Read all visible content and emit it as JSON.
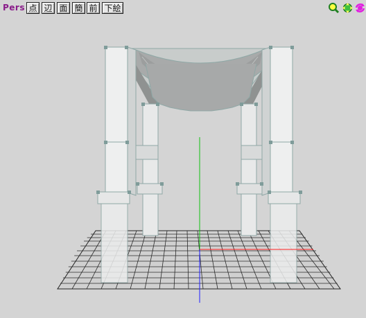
{
  "toolbar": {
    "view_mode": "Pers",
    "buttons": [
      {
        "label": "点"
      },
      {
        "label": "辺"
      },
      {
        "label": "面"
      },
      {
        "label": "簡"
      },
      {
        "label": "前"
      },
      {
        "label": "下絵"
      }
    ],
    "icons": [
      "zoom-icon",
      "move-icon",
      "rotate-icon"
    ]
  },
  "colors": {
    "view_label": "#8a1c8a",
    "x_axis": "#ff2020",
    "y_axis": "#10c010",
    "z_axis": "#2020ff",
    "model_edge": "#8fa8a6",
    "grid": "#2a2a2a"
  }
}
